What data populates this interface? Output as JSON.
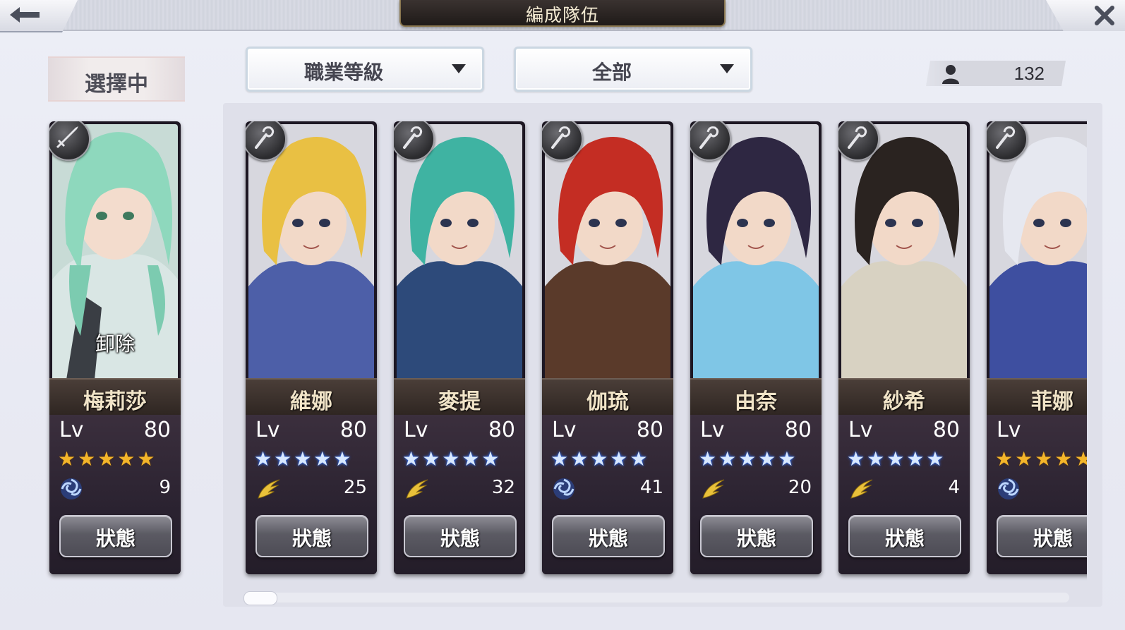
{
  "header": {
    "title": "編成隊伍",
    "back_icon": "back-arrow-icon",
    "close_icon": "close-icon"
  },
  "selected": {
    "label": "選擇中",
    "unit": {
      "name": "梅莉莎",
      "level_label": "Lv",
      "level": "80",
      "stars": 5,
      "star_style": "gold",
      "element_icon": "swirl-icon",
      "element_value": "9",
      "weapon_icon": "sword-icon",
      "overlay_text": "卸除",
      "status_label": "狀態",
      "hair_color": "#8ed8bd",
      "outfit_color": "#d9e6e4"
    }
  },
  "filters": {
    "sort_label": "職業等級",
    "filter_label": "全部",
    "arrow_icon": "chevron-down-icon"
  },
  "unit_count": "132",
  "roster": [
    {
      "name": "維娜",
      "level_label": "Lv",
      "level": "80",
      "stars": 5,
      "star_style": "blue",
      "element_icon": "wing-icon",
      "element_value": "25",
      "weapon_icon": "staff-icon",
      "status_label": "狀態",
      "hair_color": "#e9c043",
      "outfit_color": "#4d5fa8"
    },
    {
      "name": "麥提",
      "level_label": "Lv",
      "level": "80",
      "stars": 5,
      "star_style": "blue",
      "element_icon": "wing-icon",
      "element_value": "32",
      "weapon_icon": "staff-icon",
      "status_label": "狀態",
      "hair_color": "#3fb3a2",
      "outfit_color": "#2d4a7a"
    },
    {
      "name": "伽琉",
      "level_label": "Lv",
      "level": "80",
      "stars": 5,
      "star_style": "blue",
      "element_icon": "swirl-icon",
      "element_value": "41",
      "weapon_icon": "staff-icon",
      "status_label": "狀態",
      "hair_color": "#c42d23",
      "outfit_color": "#5a3a2a"
    },
    {
      "name": "由奈",
      "level_label": "Lv",
      "level": "80",
      "stars": 5,
      "star_style": "blue",
      "element_icon": "wing-icon",
      "element_value": "20",
      "weapon_icon": "staff-icon",
      "status_label": "狀態",
      "hair_color": "#2e2742",
      "outfit_color": "#7fc6e6"
    },
    {
      "name": "紗希",
      "level_label": "Lv",
      "level": "80",
      "stars": 5,
      "star_style": "blue",
      "element_icon": "wing-icon",
      "element_value": "4",
      "weapon_icon": "staff-icon",
      "status_label": "狀態",
      "hair_color": "#2a2320",
      "outfit_color": "#d8d2c2"
    },
    {
      "name": "菲娜",
      "level_label": "Lv",
      "level": "",
      "stars": 5,
      "star_style": "gold",
      "element_icon": "swirl-icon",
      "element_value": "",
      "weapon_icon": "staff-icon",
      "status_label": "狀態",
      "hair_color": "#e6e8f0",
      "outfit_color": "#3e4fa0"
    }
  ]
}
